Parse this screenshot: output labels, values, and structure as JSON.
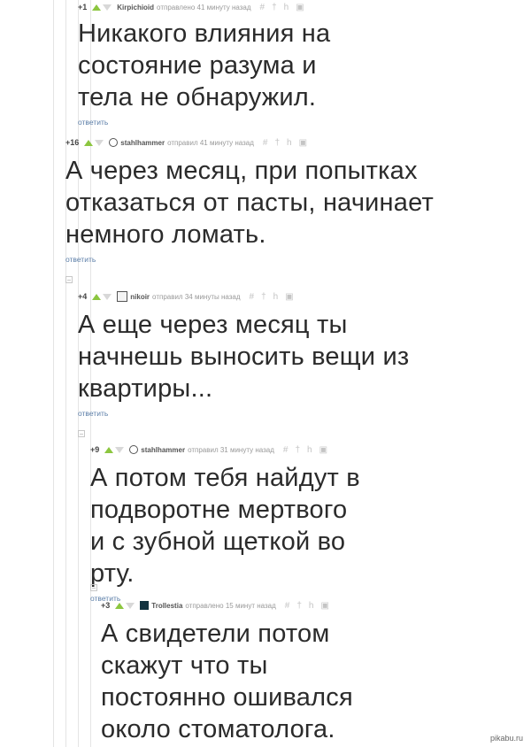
{
  "colors": {
    "upvote": "#8cc63f",
    "link": "#5b7ea8",
    "rail": "#e4e4e4"
  },
  "icons": {
    "vote_up": "triangle-up",
    "vote_down": "triangle-down",
    "tools": [
      "hash-icon",
      "dagger-icon",
      "branch-icon",
      "save-icon"
    ]
  },
  "reply_label": "ответить",
  "comments": [
    {
      "score": "+1",
      "author": "Kirpichioid",
      "action": "отправлено 41 минуту назад",
      "text": "Никакого влияния на состояние разума и тела не обнаружил."
    },
    {
      "score": "+16",
      "author": "stahlhammer",
      "action": "отправил 41 минуту назад",
      "text": "А через месяц, при попытках отказаться от пасты, начинает немного ломать."
    },
    {
      "score": "+4",
      "author": "nikoir",
      "action": "отправил 34 минуты назад",
      "text": "А еще через месяц ты начнешь выносить вещи из квартиры..."
    },
    {
      "score": "+9",
      "author": "stahlhammer",
      "action": "отправил 31 минуту назад",
      "text": "А потом тебя найдут в подворотне мертвого и с зубной щеткой во рту."
    },
    {
      "score": "+3",
      "author": "Trollestia",
      "action": "отправлено 15 минут назад",
      "text": "А свидетели потом скажут что ты постоянно ошивался около стоматолога."
    }
  ],
  "watermark": "pikabu.ru"
}
